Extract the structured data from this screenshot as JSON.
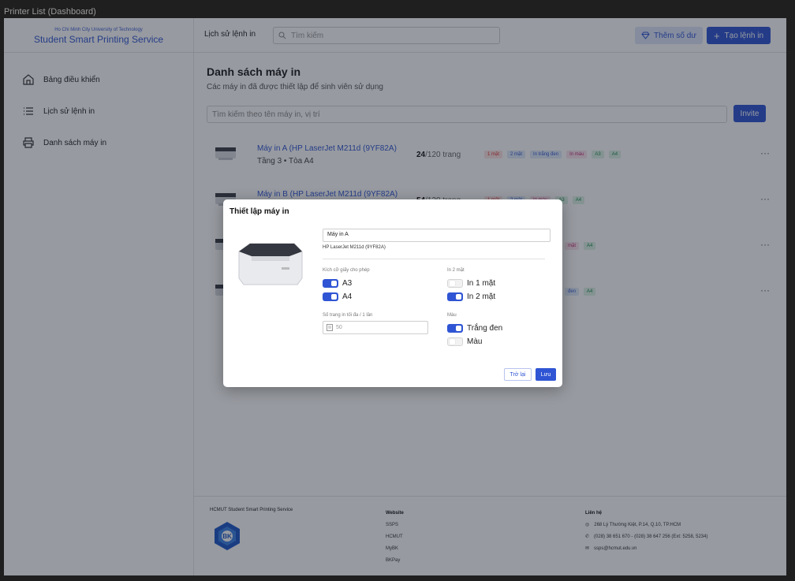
{
  "window": {
    "title": "Printer List (Dashboard)"
  },
  "brand": {
    "university": "Ho Chi Minh City University of Technology",
    "name": "Student Smart Printing Service"
  },
  "sidebar": {
    "items": [
      {
        "label": "Bảng điều khiển",
        "icon": "home-icon"
      },
      {
        "label": "Lịch sử lệnh in",
        "icon": "list-icon"
      },
      {
        "label": "Danh sách máy in",
        "icon": "printer-icon"
      }
    ]
  },
  "header": {
    "history_link": "Lịch sử lệnh in",
    "search_placeholder": "Tìm kiếm",
    "add_balance": "Thêm số dư",
    "new_job": "Tạo lệnh in"
  },
  "main": {
    "title": "Danh sách máy in",
    "subtitle": "Các máy in đã được thiết lập để sinh viên sử dụng",
    "filter_placeholder": "Tìm kiếm theo tên máy in, vị trí",
    "invite_label": "Invite",
    "printers": [
      {
        "name": "Máy in A (HP LaserJet M211d (9YF82A)",
        "location": "Tầng 3 • Tòa A4",
        "used": "24",
        "total": "/120 trang",
        "tags": [
          "1 mặt",
          "2 mặt",
          "In trắng đen",
          "In màu",
          "A3",
          "A4"
        ]
      },
      {
        "name": "Máy in B (HP LaserJet M211d (9YF82A)",
        "used": "54",
        "total": "/120 trang",
        "tags": [
          "1 mặt",
          "2 mặt",
          "In màu",
          "A3",
          "A4"
        ]
      },
      {
        "tags": [
          "mặt",
          "A4"
        ]
      },
      {
        "tags": [
          "đen",
          "A4"
        ]
      }
    ]
  },
  "footer": {
    "brand": "HCMUT Student Smart Printing Service",
    "website_heading": "Website",
    "links": [
      "SSPS",
      "HCMUT",
      "MyBK",
      "BKPay"
    ],
    "contact_heading": "Liên hệ",
    "address": "268 Lý Thường Kiệt, P.14, Q.10, TP.HCM",
    "phone": "(028) 38 651 670 - (028) 38 647 256 (Ext: 5258, 5234)",
    "email": "ssps@hcmut.edu.vn"
  },
  "modal": {
    "title": "Thiết lập máy in",
    "name_value": "Máy in A",
    "model": "HP LaserJet M211d (9YF82A)",
    "paper_label": "Kích cỡ giấy cho phép",
    "paper": [
      {
        "label": "A3",
        "on": true
      },
      {
        "label": "A4",
        "on": true
      }
    ],
    "duplex_label": "In 2 mặt",
    "duplex": [
      {
        "label": "In 1 mặt",
        "on": false
      },
      {
        "label": "In 2 mặt",
        "on": true
      }
    ],
    "max_pages_label": "Số trang in tối đa / 1 lần",
    "max_pages_placeholder": "50",
    "color_label": "Màu",
    "color": [
      {
        "label": "Trắng đen",
        "on": true
      },
      {
        "label": "Màu",
        "on": false
      }
    ],
    "back_label": "Trở lại",
    "save_label": "Lưu"
  },
  "colors": {
    "accent": "#2f55d4",
    "overlay": "#191e2d"
  }
}
